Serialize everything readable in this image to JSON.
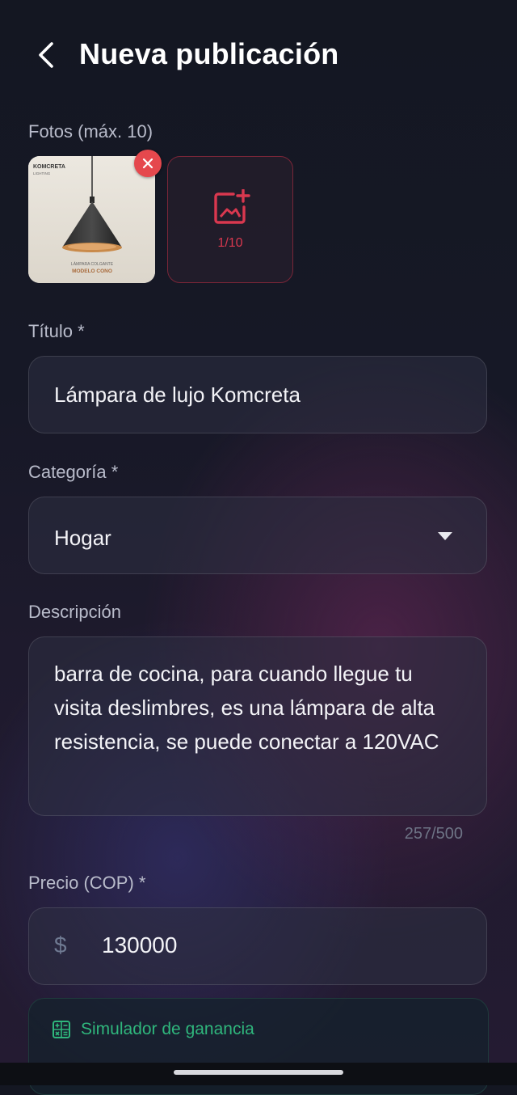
{
  "header": {
    "title": "Nueva publicación"
  },
  "photos": {
    "label": "Fotos (máx. 10)",
    "count": "1/10",
    "thumbnail": {
      "brand": "KOMCRETA",
      "brand_sub": "LIGHTING",
      "model_line": "LÁMPARA COLGANTE",
      "model_name": "MODELO CONO"
    }
  },
  "titulo": {
    "label": "Título *",
    "value": "Lámpara de lujo Komcreta"
  },
  "categoria": {
    "label": "Categoría *",
    "value": "Hogar"
  },
  "descripcion": {
    "label": "Descripción",
    "value": "barra de cocina, para cuando llegue tu visita deslimbres, es una lámpara de alta resistencia, se puede conectar a 120VAC",
    "counter": "257/500"
  },
  "precio": {
    "label": "Precio (COP) *",
    "currency": "$",
    "value": "130000"
  },
  "simulador": {
    "label": "Simulador de ganancia"
  },
  "colors": {
    "accent": "#e5484d",
    "success": "#2fb67c"
  }
}
